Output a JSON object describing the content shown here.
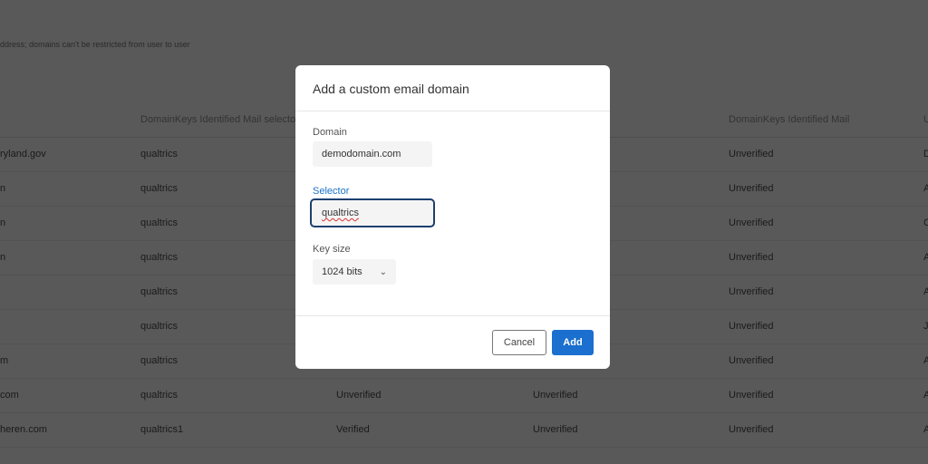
{
  "background": {
    "note": "ddress; domains can't be restricted from user to user",
    "headers": [
      "DomainKeys Identified Mail selector",
      "DomainKeys Identified Mail",
      "U"
    ],
    "rows": [
      {
        "domain": "ryland.gov",
        "selector": "qualtrics",
        "c3": "",
        "c4": "",
        "dkim": "Unverified",
        "c6": "D"
      },
      {
        "domain": "n",
        "selector": "qualtrics",
        "c3": "",
        "c4": "",
        "dkim": "Unverified",
        "c6": "A"
      },
      {
        "domain": "n",
        "selector": "qualtrics",
        "c3": "",
        "c4": "",
        "dkim": "Unverified",
        "c6": "C"
      },
      {
        "domain": "n",
        "selector": "qualtrics",
        "c3": "",
        "c4": "",
        "dkim": "Unverified",
        "c6": "A"
      },
      {
        "domain": "",
        "selector": "qualtrics",
        "c3": "",
        "c4": "",
        "dkim": "Unverified",
        "c6": "A"
      },
      {
        "domain": "",
        "selector": "qualtrics",
        "c3": "",
        "c4": "",
        "dkim": "Unverified",
        "c6": "J"
      },
      {
        "domain": "m",
        "selector": "qualtrics",
        "c3": "",
        "c4": "",
        "dkim": "Unverified",
        "c6": "A"
      },
      {
        "domain": "com",
        "selector": "qualtrics",
        "c3": "Unverified",
        "c4": "Unverified",
        "dkim": "Unverified",
        "c6": "A"
      },
      {
        "domain": "heren.com",
        "selector": "qualtrics1",
        "c3": "Verified",
        "c4": "Unverified",
        "dkim": "Unverified",
        "c6": "A"
      }
    ]
  },
  "modal": {
    "title": "Add a custom email domain",
    "domain_label": "Domain",
    "domain_value": "demodomain.com",
    "selector_label": "Selector",
    "selector_value": "qualtrics",
    "keysize_label": "Key size",
    "keysize_value": "1024 bits",
    "cancel": "Cancel",
    "add": "Add"
  },
  "colors": {
    "accent": "#1a6fcf",
    "overlay": "#595959"
  }
}
